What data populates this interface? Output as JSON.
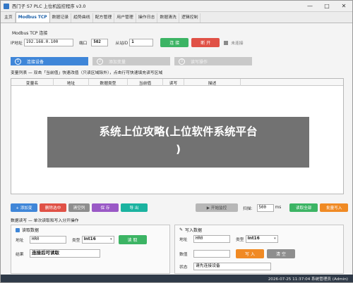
{
  "window": {
    "title": "西门子 S7 PLC 上位机监控程序 v3.0",
    "controls": {
      "minimize": "—",
      "maximize": "□",
      "close": "✕"
    }
  },
  "tabs": [
    "主页",
    "Modbus TCP",
    "数据记录",
    "趋势曲线",
    "配方管理",
    "用户管理",
    "操作日志",
    "数据清洗",
    "逻辑控制"
  ],
  "connection": {
    "section_title": "Modbus TCP 连接",
    "ip_label": "IP地址",
    "ip_value": "192.168.0.100",
    "port_label": "端口",
    "port_value": "502",
    "slave_label": "从站ID",
    "slave_value": "1",
    "connect_label": "连 接",
    "disconnect_label": "断 开",
    "status_text": "未连接",
    "status_color": "#8a8a8a"
  },
  "steps": [
    {
      "num": "1",
      "label": "连接设备"
    },
    {
      "num": "2",
      "label": "添加变量"
    },
    {
      "num": "3",
      "label": "读写操作"
    }
  ],
  "variables": {
    "section_title": "变量列表 — 双击「当前值」快速改值（只读区域除外），点击行可快速填充读写区域",
    "columns": [
      "变量名",
      "地址",
      "数据类型",
      "当前值",
      "读写",
      "描述"
    ]
  },
  "overlay": {
    "line1": "系统上位攻略(上位软件系统平台",
    "line2": ")"
  },
  "toolbar": {
    "add": "+ 添加变",
    "delete": "删除选中",
    "clear": "清空列",
    "save": "保 存",
    "export": "导 出",
    "monitor": "▶ 开始监控",
    "scan_label": "扫描:",
    "scan_value": "500",
    "scan_unit": "ms",
    "read_all": "读取全部",
    "write_batch": "批量写入"
  },
  "rw": {
    "section_title": "数据读写 — 单次读取和写入分开操作",
    "read": {
      "title": "读取数据",
      "addr_label": "地址",
      "addr_value": "HR0",
      "type_label": "类型",
      "type_value": "Int16",
      "read_btn": "读 取",
      "result_label": "结果",
      "result_value": "连接后可读取"
    },
    "write": {
      "title": "写入数据",
      "addr_label": "地址",
      "addr_value": "HR0",
      "type_label": "类型",
      "type_value": "Int16",
      "value_label": "数值",
      "write_btn": "写 入",
      "clear_btn": "清 空",
      "status_label": "状态",
      "status_value": "请先连接设备"
    }
  },
  "statusbar": {
    "text": "2026-07-25 11:37:04  系统管理员 (Admin)"
  }
}
